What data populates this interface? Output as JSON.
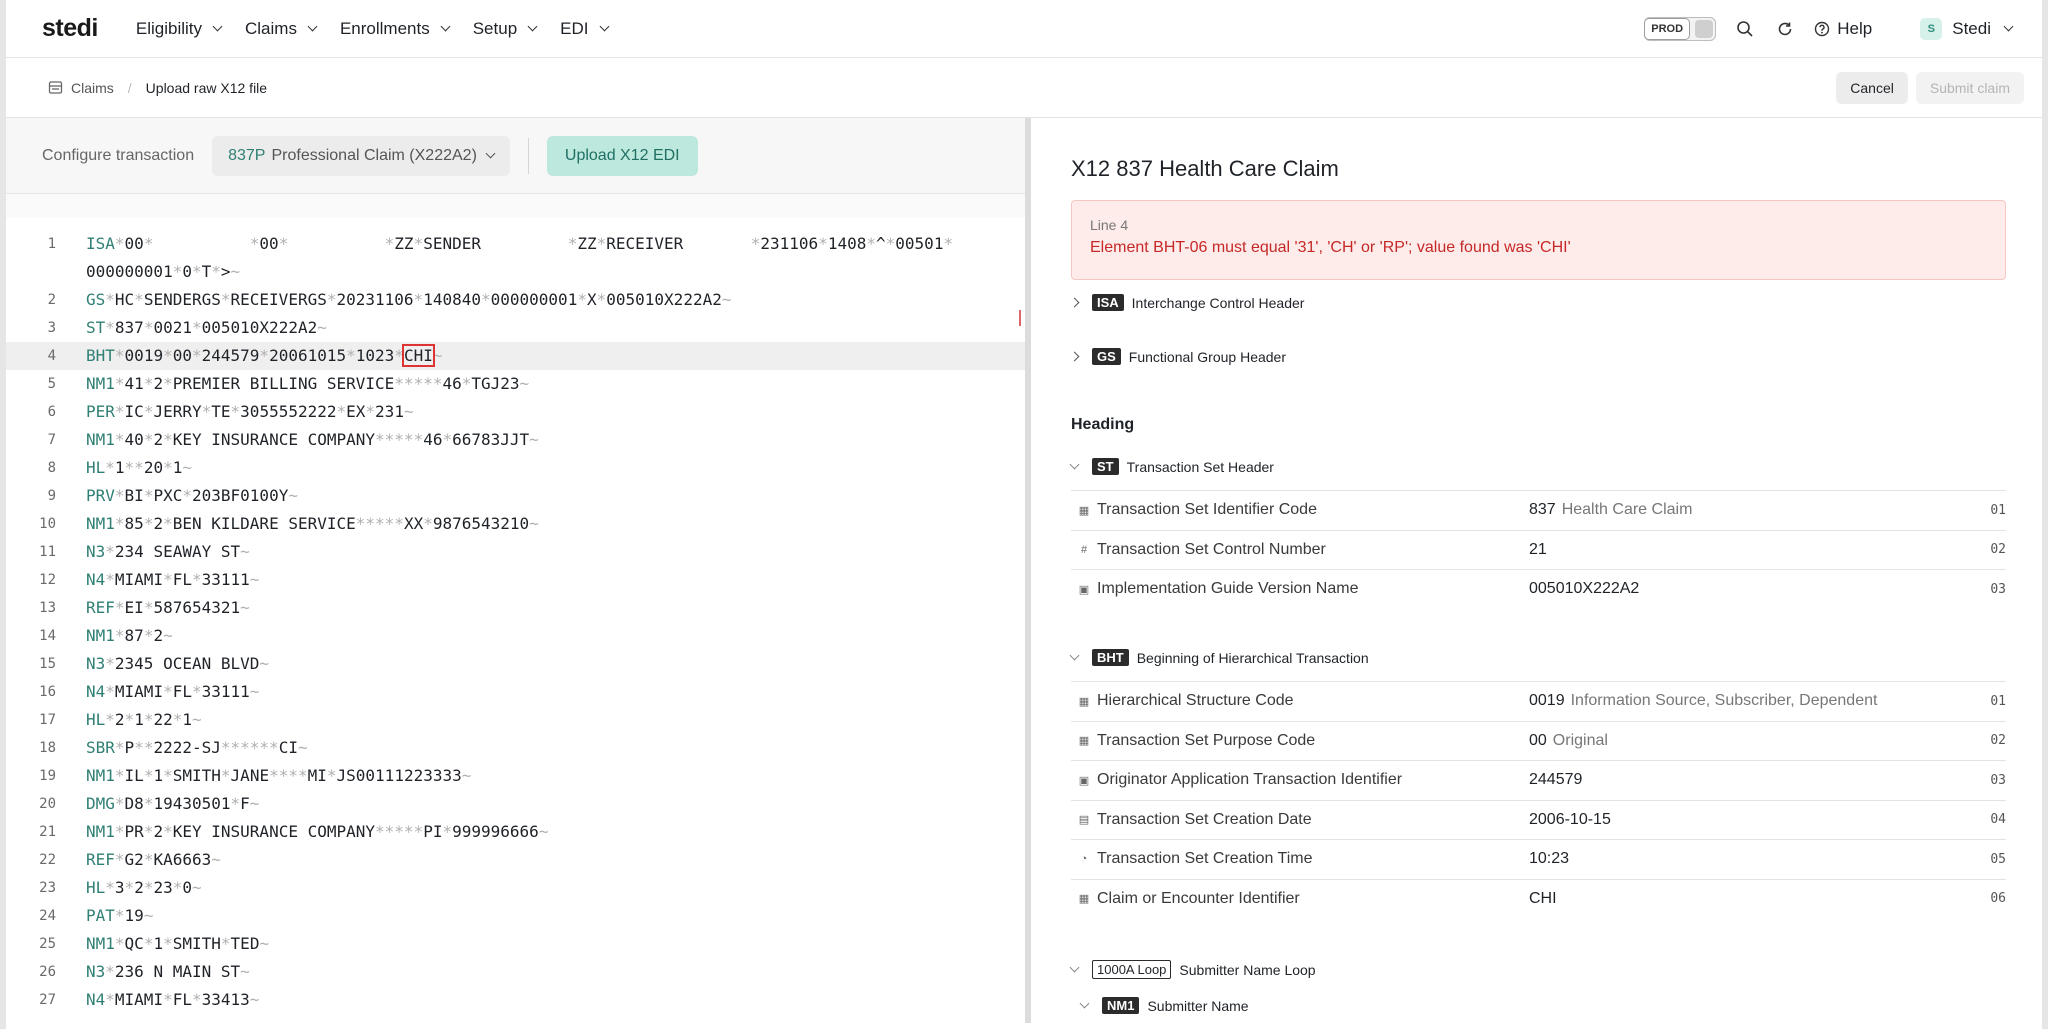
{
  "nav": {
    "logo": "stedi",
    "items": [
      "Eligibility",
      "Claims",
      "Enrollments",
      "Setup",
      "EDI"
    ],
    "env_badge": "PROD",
    "help": "Help",
    "user_initial": "S",
    "user_name": "Stedi"
  },
  "breadcrumb": {
    "root": "Claims",
    "current": "Upload raw X12 file"
  },
  "actions": {
    "cancel": "Cancel",
    "submit": "Submit claim"
  },
  "config": {
    "label": "Configure transaction",
    "select_code": "837P",
    "select_text": "Professional Claim (X222A2)",
    "upload": "Upload X12 EDI"
  },
  "code_lines": [
    {
      "n": "1",
      "parts": [
        [
          "s",
          "ISA"
        ],
        [
          "d",
          "*"
        ],
        [
          "t",
          "00"
        ],
        [
          "d",
          "*"
        ],
        [
          "t",
          "          "
        ],
        [
          "d",
          "*"
        ],
        [
          "t",
          "00"
        ],
        [
          "d",
          "*"
        ],
        [
          "t",
          "          "
        ],
        [
          "d",
          "*"
        ],
        [
          "t",
          "ZZ"
        ],
        [
          "d",
          "*"
        ],
        [
          "t",
          "SENDER         "
        ],
        [
          "d",
          "*"
        ],
        [
          "t",
          "ZZ"
        ],
        [
          "d",
          "*"
        ],
        [
          "t",
          "RECEIVER       "
        ],
        [
          "d",
          "*"
        ],
        [
          "t",
          "231106"
        ],
        [
          "d",
          "*"
        ],
        [
          "t",
          "1408"
        ],
        [
          "d",
          "*"
        ],
        [
          "t",
          "^"
        ],
        [
          "d",
          "*"
        ],
        [
          "t",
          "00501"
        ],
        [
          "d",
          "*"
        ]
      ]
    },
    {
      "n": "",
      "parts": [
        [
          "t",
          "000000001"
        ],
        [
          "d",
          "*"
        ],
        [
          "t",
          "0"
        ],
        [
          "d",
          "*"
        ],
        [
          "t",
          "T"
        ],
        [
          "d",
          "*"
        ],
        [
          "t",
          ">"
        ],
        [
          "d",
          "~"
        ]
      ]
    },
    {
      "n": "2",
      "parts": [
        [
          "s",
          "GS"
        ],
        [
          "d",
          "*"
        ],
        [
          "t",
          "HC"
        ],
        [
          "d",
          "*"
        ],
        [
          "t",
          "SENDERGS"
        ],
        [
          "d",
          "*"
        ],
        [
          "t",
          "RECEIVERGS"
        ],
        [
          "d",
          "*"
        ],
        [
          "t",
          "20231106"
        ],
        [
          "d",
          "*"
        ],
        [
          "t",
          "140840"
        ],
        [
          "d",
          "*"
        ],
        [
          "t",
          "000000001"
        ],
        [
          "d",
          "*"
        ],
        [
          "t",
          "X"
        ],
        [
          "d",
          "*"
        ],
        [
          "t",
          "005010X222A2"
        ],
        [
          "d",
          "~"
        ]
      ]
    },
    {
      "n": "3",
      "parts": [
        [
          "s",
          "ST"
        ],
        [
          "d",
          "*"
        ],
        [
          "t",
          "837"
        ],
        [
          "d",
          "*"
        ],
        [
          "t",
          "0021"
        ],
        [
          "d",
          "*"
        ],
        [
          "t",
          "005010X222A2"
        ],
        [
          "d",
          "~"
        ]
      ]
    },
    {
      "n": "4",
      "hl": true,
      "parts": [
        [
          "s",
          "BHT"
        ],
        [
          "d",
          "*"
        ],
        [
          "t",
          "0019"
        ],
        [
          "d",
          "*"
        ],
        [
          "t",
          "00"
        ],
        [
          "d",
          "*"
        ],
        [
          "t",
          "244579"
        ],
        [
          "d",
          "*"
        ],
        [
          "t",
          "20061015"
        ],
        [
          "d",
          "*"
        ],
        [
          "t",
          "1023"
        ],
        [
          "d",
          "*"
        ],
        [
          "e",
          "CHI"
        ],
        [
          "d",
          "~"
        ]
      ]
    },
    {
      "n": "5",
      "parts": [
        [
          "s",
          "NM1"
        ],
        [
          "d",
          "*"
        ],
        [
          "t",
          "41"
        ],
        [
          "d",
          "*"
        ],
        [
          "t",
          "2"
        ],
        [
          "d",
          "*"
        ],
        [
          "t",
          "PREMIER BILLING SERVICE"
        ],
        [
          "d",
          "*****"
        ],
        [
          "t",
          "46"
        ],
        [
          "d",
          "*"
        ],
        [
          "t",
          "TGJ23"
        ],
        [
          "d",
          "~"
        ]
      ]
    },
    {
      "n": "6",
      "parts": [
        [
          "s",
          "PER"
        ],
        [
          "d",
          "*"
        ],
        [
          "t",
          "IC"
        ],
        [
          "d",
          "*"
        ],
        [
          "t",
          "JERRY"
        ],
        [
          "d",
          "*"
        ],
        [
          "t",
          "TE"
        ],
        [
          "d",
          "*"
        ],
        [
          "t",
          "3055552222"
        ],
        [
          "d",
          "*"
        ],
        [
          "t",
          "EX"
        ],
        [
          "d",
          "*"
        ],
        [
          "t",
          "231"
        ],
        [
          "d",
          "~"
        ]
      ]
    },
    {
      "n": "7",
      "parts": [
        [
          "s",
          "NM1"
        ],
        [
          "d",
          "*"
        ],
        [
          "t",
          "40"
        ],
        [
          "d",
          "*"
        ],
        [
          "t",
          "2"
        ],
        [
          "d",
          "*"
        ],
        [
          "t",
          "KEY INSURANCE COMPANY"
        ],
        [
          "d",
          "*****"
        ],
        [
          "t",
          "46"
        ],
        [
          "d",
          "*"
        ],
        [
          "t",
          "66783JJT"
        ],
        [
          "d",
          "~"
        ]
      ]
    },
    {
      "n": "8",
      "parts": [
        [
          "s",
          "HL"
        ],
        [
          "d",
          "*"
        ],
        [
          "t",
          "1"
        ],
        [
          "d",
          "**"
        ],
        [
          "t",
          "20"
        ],
        [
          "d",
          "*"
        ],
        [
          "t",
          "1"
        ],
        [
          "d",
          "~"
        ]
      ]
    },
    {
      "n": "9",
      "parts": [
        [
          "s",
          "PRV"
        ],
        [
          "d",
          "*"
        ],
        [
          "t",
          "BI"
        ],
        [
          "d",
          "*"
        ],
        [
          "t",
          "PXC"
        ],
        [
          "d",
          "*"
        ],
        [
          "t",
          "203BF0100Y"
        ],
        [
          "d",
          "~"
        ]
      ]
    },
    {
      "n": "10",
      "parts": [
        [
          "s",
          "NM1"
        ],
        [
          "d",
          "*"
        ],
        [
          "t",
          "85"
        ],
        [
          "d",
          "*"
        ],
        [
          "t",
          "2"
        ],
        [
          "d",
          "*"
        ],
        [
          "t",
          "BEN KILDARE SERVICE"
        ],
        [
          "d",
          "*****"
        ],
        [
          "t",
          "XX"
        ],
        [
          "d",
          "*"
        ],
        [
          "t",
          "9876543210"
        ],
        [
          "d",
          "~"
        ]
      ]
    },
    {
      "n": "11",
      "parts": [
        [
          "s",
          "N3"
        ],
        [
          "d",
          "*"
        ],
        [
          "t",
          "234 SEAWAY ST"
        ],
        [
          "d",
          "~"
        ]
      ]
    },
    {
      "n": "12",
      "parts": [
        [
          "s",
          "N4"
        ],
        [
          "d",
          "*"
        ],
        [
          "t",
          "MIAMI"
        ],
        [
          "d",
          "*"
        ],
        [
          "t",
          "FL"
        ],
        [
          "d",
          "*"
        ],
        [
          "t",
          "33111"
        ],
        [
          "d",
          "~"
        ]
      ]
    },
    {
      "n": "13",
      "parts": [
        [
          "s",
          "REF"
        ],
        [
          "d",
          "*"
        ],
        [
          "t",
          "EI"
        ],
        [
          "d",
          "*"
        ],
        [
          "t",
          "587654321"
        ],
        [
          "d",
          "~"
        ]
      ]
    },
    {
      "n": "14",
      "parts": [
        [
          "s",
          "NM1"
        ],
        [
          "d",
          "*"
        ],
        [
          "t",
          "87"
        ],
        [
          "d",
          "*"
        ],
        [
          "t",
          "2"
        ],
        [
          "d",
          "~"
        ]
      ]
    },
    {
      "n": "15",
      "parts": [
        [
          "s",
          "N3"
        ],
        [
          "d",
          "*"
        ],
        [
          "t",
          "2345 OCEAN BLVD"
        ],
        [
          "d",
          "~"
        ]
      ]
    },
    {
      "n": "16",
      "parts": [
        [
          "s",
          "N4"
        ],
        [
          "d",
          "*"
        ],
        [
          "t",
          "MIAMI"
        ],
        [
          "d",
          "*"
        ],
        [
          "t",
          "FL"
        ],
        [
          "d",
          "*"
        ],
        [
          "t",
          "33111"
        ],
        [
          "d",
          "~"
        ]
      ]
    },
    {
      "n": "17",
      "parts": [
        [
          "s",
          "HL"
        ],
        [
          "d",
          "*"
        ],
        [
          "t",
          "2"
        ],
        [
          "d",
          "*"
        ],
        [
          "t",
          "1"
        ],
        [
          "d",
          "*"
        ],
        [
          "t",
          "22"
        ],
        [
          "d",
          "*"
        ],
        [
          "t",
          "1"
        ],
        [
          "d",
          "~"
        ]
      ]
    },
    {
      "n": "18",
      "parts": [
        [
          "s",
          "SBR"
        ],
        [
          "d",
          "*"
        ],
        [
          "t",
          "P"
        ],
        [
          "d",
          "**"
        ],
        [
          "t",
          "2222-SJ"
        ],
        [
          "d",
          "******"
        ],
        [
          "t",
          "CI"
        ],
        [
          "d",
          "~"
        ]
      ]
    },
    {
      "n": "19",
      "parts": [
        [
          "s",
          "NM1"
        ],
        [
          "d",
          "*"
        ],
        [
          "t",
          "IL"
        ],
        [
          "d",
          "*"
        ],
        [
          "t",
          "1"
        ],
        [
          "d",
          "*"
        ],
        [
          "t",
          "SMITH"
        ],
        [
          "d",
          "*"
        ],
        [
          "t",
          "JANE"
        ],
        [
          "d",
          "****"
        ],
        [
          "t",
          "MI"
        ],
        [
          "d",
          "*"
        ],
        [
          "t",
          "JS00111223333"
        ],
        [
          "d",
          "~"
        ]
      ]
    },
    {
      "n": "20",
      "parts": [
        [
          "s",
          "DMG"
        ],
        [
          "d",
          "*"
        ],
        [
          "t",
          "D8"
        ],
        [
          "d",
          "*"
        ],
        [
          "t",
          "19430501"
        ],
        [
          "d",
          "*"
        ],
        [
          "t",
          "F"
        ],
        [
          "d",
          "~"
        ]
      ]
    },
    {
      "n": "21",
      "parts": [
        [
          "s",
          "NM1"
        ],
        [
          "d",
          "*"
        ],
        [
          "t",
          "PR"
        ],
        [
          "d",
          "*"
        ],
        [
          "t",
          "2"
        ],
        [
          "d",
          "*"
        ],
        [
          "t",
          "KEY INSURANCE COMPANY"
        ],
        [
          "d",
          "*****"
        ],
        [
          "t",
          "PI"
        ],
        [
          "d",
          "*"
        ],
        [
          "t",
          "999996666"
        ],
        [
          "d",
          "~"
        ]
      ]
    },
    {
      "n": "22",
      "parts": [
        [
          "s",
          "REF"
        ],
        [
          "d",
          "*"
        ],
        [
          "t",
          "G2"
        ],
        [
          "d",
          "*"
        ],
        [
          "t",
          "KA6663"
        ],
        [
          "d",
          "~"
        ]
      ]
    },
    {
      "n": "23",
      "parts": [
        [
          "s",
          "HL"
        ],
        [
          "d",
          "*"
        ],
        [
          "t",
          "3"
        ],
        [
          "d",
          "*"
        ],
        [
          "t",
          "2"
        ],
        [
          "d",
          "*"
        ],
        [
          "t",
          "23"
        ],
        [
          "d",
          "*"
        ],
        [
          "t",
          "0"
        ],
        [
          "d",
          "~"
        ]
      ]
    },
    {
      "n": "24",
      "parts": [
        [
          "s",
          "PAT"
        ],
        [
          "d",
          "*"
        ],
        [
          "t",
          "19"
        ],
        [
          "d",
          "~"
        ]
      ]
    },
    {
      "n": "25",
      "parts": [
        [
          "s",
          "NM1"
        ],
        [
          "d",
          "*"
        ],
        [
          "t",
          "QC"
        ],
        [
          "d",
          "*"
        ],
        [
          "t",
          "1"
        ],
        [
          "d",
          "*"
        ],
        [
          "t",
          "SMITH"
        ],
        [
          "d",
          "*"
        ],
        [
          "t",
          "TED"
        ],
        [
          "d",
          "~"
        ]
      ]
    },
    {
      "n": "26",
      "parts": [
        [
          "s",
          "N3"
        ],
        [
          "d",
          "*"
        ],
        [
          "t",
          "236 N MAIN ST"
        ],
        [
          "d",
          "~"
        ]
      ]
    },
    {
      "n": "27",
      "parts": [
        [
          "s",
          "N4"
        ],
        [
          "d",
          "*"
        ],
        [
          "t",
          "MIAMI"
        ],
        [
          "d",
          "*"
        ],
        [
          "t",
          "FL"
        ],
        [
          "d",
          "*"
        ],
        [
          "t",
          "33413"
        ],
        [
          "d",
          "~"
        ]
      ]
    }
  ],
  "right": {
    "title": "X12 837 Health Care Claim",
    "error": {
      "line": "Line 4",
      "message": "Element BHT-06 must equal '31', 'CH' or 'RP'; value found was 'CHI'"
    },
    "isa": {
      "tag": "ISA",
      "label": "Interchange Control Header"
    },
    "gs": {
      "tag": "GS",
      "label": "Functional Group Header"
    },
    "heading": "Heading",
    "st": {
      "tag": "ST",
      "label": "Transaction Set Header",
      "rows": [
        {
          "icon": "grid-icon",
          "glyph": "▦",
          "name": "Transaction Set Identifier Code",
          "value": "837",
          "desc": "Health Care Claim",
          "num": "01"
        },
        {
          "icon": "hash-icon",
          "glyph": "#",
          "name": "Transaction Set Control Number",
          "value": "21",
          "desc": "",
          "num": "02"
        },
        {
          "icon": "text-icon",
          "glyph": "▣",
          "name": "Implementation Guide Version Name",
          "value": "005010X222A2",
          "desc": "",
          "num": "03"
        }
      ]
    },
    "bht": {
      "tag": "BHT",
      "label": "Beginning of Hierarchical Transaction",
      "rows": [
        {
          "icon": "grid-icon",
          "glyph": "▦",
          "name": "Hierarchical Structure Code",
          "value": "0019",
          "desc": "Information Source, Subscriber, Dependent",
          "num": "01"
        },
        {
          "icon": "grid-icon",
          "glyph": "▦",
          "name": "Transaction Set Purpose Code",
          "value": "00",
          "desc": "Original",
          "num": "02"
        },
        {
          "icon": "text-icon",
          "glyph": "▣",
          "name": "Originator Application Transaction Identifier",
          "value": "244579",
          "desc": "",
          "num": "03"
        },
        {
          "icon": "calendar-icon",
          "glyph": "▤",
          "name": "Transaction Set Creation Date",
          "value": "2006-10-15",
          "desc": "",
          "num": "04"
        },
        {
          "icon": "clock-icon",
          "glyph": "◔",
          "name": "Transaction Set Creation Time",
          "value": "10:23",
          "desc": "",
          "num": "05"
        },
        {
          "icon": "grid-icon",
          "glyph": "▦",
          "name": "Claim or Encounter Identifier",
          "value": "CHI",
          "desc": "",
          "num": "06"
        }
      ]
    },
    "loop1000a": {
      "tag": "1000A Loop",
      "label": "Submitter Name Loop"
    },
    "nm1": {
      "tag": "NM1",
      "label": "Submitter Name"
    }
  }
}
